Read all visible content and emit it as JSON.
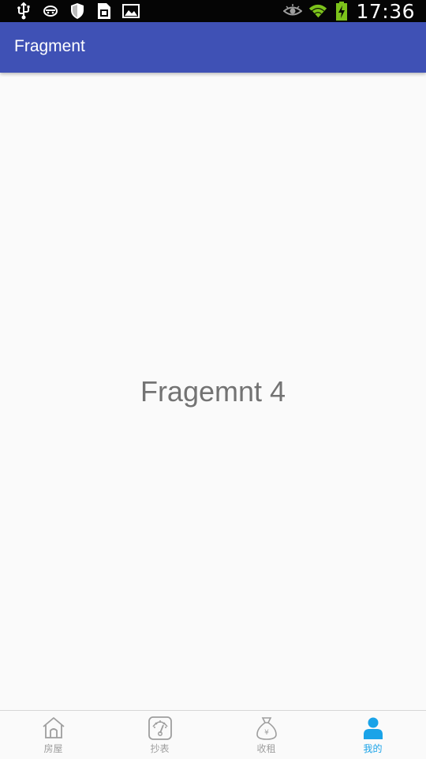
{
  "status_bar": {
    "time": "17:36",
    "left_icons": [
      "usb-icon",
      "game-icon",
      "shield-icon",
      "sim-icon",
      "image-icon"
    ],
    "right_icons": [
      "eye-icon",
      "wifi-icon",
      "battery-charging-icon"
    ]
  },
  "app_bar": {
    "title": "Fragment",
    "color": "#3f51b5"
  },
  "content": {
    "text": "Fragemnt 4"
  },
  "bottom_nav": {
    "active_color": "#1aa3e8",
    "items": [
      {
        "label": "房屋",
        "icon": "house-icon",
        "active": false
      },
      {
        "label": "抄表",
        "icon": "meter-icon",
        "active": false
      },
      {
        "label": "收租",
        "icon": "money-bag-icon",
        "active": false
      },
      {
        "label": "我的",
        "icon": "person-icon",
        "active": true
      }
    ]
  }
}
